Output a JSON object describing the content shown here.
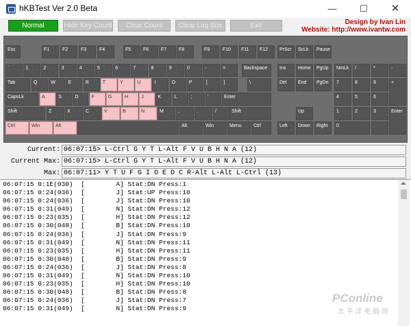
{
  "window": {
    "title": "hKBTest Ver 2.0 Beta",
    "min": "—",
    "max": "☐",
    "close": "✕"
  },
  "toolbar": {
    "normal": "Normal",
    "hide_key_count": "Hide Key Count",
    "clear_count": "Clear Count",
    "clear_log_box": "Clear Log Box",
    "exit": "Exit",
    "designer_line": "Design by Ivan Lin",
    "website_line": "Website: http://www.ivantw.com"
  },
  "colors": {
    "pressed_key": "#f6c3c6",
    "key": "#545454",
    "normal_button": "#1a9f1a",
    "designer": "#b01010"
  },
  "keys": [
    {
      "label": "Esc",
      "pressed": false
    },
    {
      "label": "F1",
      "pressed": false
    },
    {
      "label": "F2",
      "pressed": false
    },
    {
      "label": "F3",
      "pressed": false
    },
    {
      "label": "F4",
      "pressed": false
    },
    {
      "label": "F5",
      "pressed": false
    },
    {
      "label": "F6",
      "pressed": false
    },
    {
      "label": "F7",
      "pressed": false
    },
    {
      "label": "F8",
      "pressed": false
    },
    {
      "label": "F9",
      "pressed": false
    },
    {
      "label": "F10",
      "pressed": false
    },
    {
      "label": "F11",
      "pressed": false
    },
    {
      "label": "F12",
      "pressed": false
    },
    {
      "label": "PrScr",
      "pressed": false
    },
    {
      "label": "ScLk",
      "pressed": false
    },
    {
      "label": "Pause",
      "pressed": false
    },
    {
      "label": "`",
      "pressed": false
    },
    {
      "label": "1",
      "pressed": false
    },
    {
      "label": "2",
      "pressed": false
    },
    {
      "label": "3",
      "pressed": false
    },
    {
      "label": "4",
      "pressed": false
    },
    {
      "label": "5",
      "pressed": false
    },
    {
      "label": "6",
      "pressed": false
    },
    {
      "label": "7",
      "pressed": false
    },
    {
      "label": "8",
      "pressed": false
    },
    {
      "label": "9",
      "pressed": false
    },
    {
      "label": "0",
      "pressed": false
    },
    {
      "label": "-",
      "pressed": false
    },
    {
      "label": "=",
      "pressed": false
    },
    {
      "label": "Backspace",
      "pressed": false
    },
    {
      "label": "Ins",
      "pressed": false
    },
    {
      "label": "Home",
      "pressed": false
    },
    {
      "label": "PgUp",
      "pressed": false
    },
    {
      "label": "NmLk",
      "pressed": false
    },
    {
      "label": "/",
      "pressed": false
    },
    {
      "label": "*",
      "pressed": false
    },
    {
      "label": "-",
      "pressed": false
    },
    {
      "label": "Tab",
      "pressed": false
    },
    {
      "label": "Q",
      "pressed": false
    },
    {
      "label": "W",
      "pressed": false
    },
    {
      "label": "E",
      "pressed": false
    },
    {
      "label": "R",
      "pressed": false
    },
    {
      "label": "T",
      "pressed": true
    },
    {
      "label": "Y",
      "pressed": true
    },
    {
      "label": "U",
      "pressed": true
    },
    {
      "label": "I",
      "pressed": false
    },
    {
      "label": "O",
      "pressed": false
    },
    {
      "label": "P",
      "pressed": false
    },
    {
      "label": "[",
      "pressed": false
    },
    {
      "label": "]",
      "pressed": false
    },
    {
      "label": "\\",
      "pressed": false
    },
    {
      "label": "Del",
      "pressed": false
    },
    {
      "label": "End",
      "pressed": false
    },
    {
      "label": "PgDn",
      "pressed": false
    },
    {
      "label": "7",
      "pressed": false
    },
    {
      "label": "8",
      "pressed": false
    },
    {
      "label": "9",
      "pressed": false
    },
    {
      "label": "+",
      "pressed": false
    },
    {
      "label": "CapsLk",
      "pressed": false
    },
    {
      "label": "A",
      "pressed": true
    },
    {
      "label": "S",
      "pressed": false
    },
    {
      "label": "D",
      "pressed": false
    },
    {
      "label": "F",
      "pressed": true
    },
    {
      "label": "G",
      "pressed": true
    },
    {
      "label": "H",
      "pressed": true
    },
    {
      "label": "J",
      "pressed": true
    },
    {
      "label": "K",
      "pressed": false
    },
    {
      "label": "L",
      "pressed": false
    },
    {
      "label": ";",
      "pressed": false
    },
    {
      "label": "'",
      "pressed": false
    },
    {
      "label": "Enter",
      "pressed": false
    },
    {
      "label": "4",
      "pressed": false
    },
    {
      "label": "5",
      "pressed": false
    },
    {
      "label": "6",
      "pressed": false
    },
    {
      "label": "Shift",
      "pressed": false
    },
    {
      "label": "Z",
      "pressed": false
    },
    {
      "label": "X",
      "pressed": false
    },
    {
      "label": "C",
      "pressed": false
    },
    {
      "label": "V",
      "pressed": true
    },
    {
      "label": "B",
      "pressed": true
    },
    {
      "label": "N",
      "pressed": true
    },
    {
      "label": "M",
      "pressed": false
    },
    {
      "label": ",",
      "pressed": false
    },
    {
      "label": ".",
      "pressed": false
    },
    {
      "label": "/",
      "pressed": false
    },
    {
      "label": "Shift",
      "pressed": false
    },
    {
      "label": "Up",
      "pressed": false
    },
    {
      "label": "1",
      "pressed": false
    },
    {
      "label": "2",
      "pressed": false
    },
    {
      "label": "3",
      "pressed": false
    },
    {
      "label": "Enter",
      "pressed": false
    },
    {
      "label": "Ctrl",
      "pressed": true
    },
    {
      "label": "Win",
      "pressed": true
    },
    {
      "label": "Alt",
      "pressed": true
    },
    {
      "label": "",
      "pressed": false
    },
    {
      "label": "Alt",
      "pressed": false
    },
    {
      "label": "Win",
      "pressed": false
    },
    {
      "label": "Menu",
      "pressed": false
    },
    {
      "label": "Ctrl",
      "pressed": false
    },
    {
      "label": "Left",
      "pressed": false
    },
    {
      "label": "Down",
      "pressed": false
    },
    {
      "label": "Right",
      "pressed": false
    },
    {
      "label": "0",
      "pressed": false
    },
    {
      "label": ".",
      "pressed": false
    }
  ],
  "stats": {
    "current_label": "Current:",
    "current_value": "06:07:15> L-Ctrl G Y T L-Alt F V U B H N A (12)",
    "current_max_label": "Current Max:",
    "current_max_value": "06:07:15> L-Ctrl G Y T L-Alt F V U B H N A (12)",
    "max_label": "Max:",
    "max_value": "06:07:11> Y T U F G I O E D C R-Alt L-Alt L-Ctrl (13)"
  },
  "log": [
    "06:07:15 0:1E(030)  [        A] Stat:DN Press:1",
    "06:07:15 0:24(036)  [        J] Stat:UP Press:10",
    "06:07:15 0:24(036)  [        J] Stat:DN Press:10",
    "06:07:15 0:31(049)  [        N] Stat:DN Press:12",
    "06:07:15 0:23(035)  [        H] Stat:DN Press:12",
    "06:07:15 0:30(048)  [        B] Stat:DN Press:10",
    "06:07:15 0:24(036)  [        J] Stat:DN Press:9",
    "06:07:15 0:31(049)  [        N] Stat:DN Press:11",
    "06:07:15 0:23(035)  [        H] Stat:DN Press:11",
    "06:07:15 0:30(048)  [        B] Stat:DN Press:9",
    "06:07:15 0:24(036)  [        J] Stat:DN Press:8",
    "06:07:15 0:31(049)  [        N] Stat:DN Press:10",
    "06:07:15 0:23(035)  [        H] Stat:DN Press:10",
    "06:07:15 0:30(048)  [        B] Stat:DN Press:8",
    "06:07:15 0:24(036)  [        J] Stat:DN Press:7",
    "06:07:15 0:31(049)  [        N] Stat:DN Press:9"
  ],
  "watermark": {
    "brand": "PConline",
    "sub": "太 平 洋 电 脑 网"
  }
}
